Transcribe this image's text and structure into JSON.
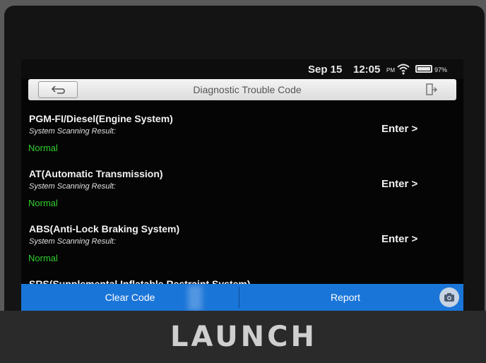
{
  "status_bar": {
    "date": "Sep 15",
    "time": "12:05",
    "ampm": "PM",
    "battery": "97%",
    "wifi_icon": "wifi-icon",
    "battery_icon": "battery-icon"
  },
  "title_bar": {
    "title": "Diagnostic Trouble Code",
    "back_icon": "back-arrow-icon",
    "exit_icon": "exit-icon"
  },
  "systems": [
    {
      "name": "PGM-FI/Diesel(Engine System)",
      "result_label": "System Scanning Result:",
      "status": "Normal",
      "action": "Enter >"
    },
    {
      "name": "AT(Automatic Transmission)",
      "result_label": "System Scanning Result:",
      "status": "Normal",
      "action": "Enter >"
    },
    {
      "name": "ABS(Anti-Lock Braking System)",
      "result_label": "System Scanning Result:",
      "status": "Normal",
      "action": "Enter >"
    },
    {
      "name": "SRS(Supplemental Inflatable Restraint System)"
    }
  ],
  "actions": {
    "clear": "Clear Code",
    "report": "Report",
    "camera_icon": "camera-icon"
  },
  "device": {
    "brand": "LAUNCH"
  },
  "colors": {
    "action_bar": "#1a75d8",
    "status_ok": "#2fcf2f"
  }
}
